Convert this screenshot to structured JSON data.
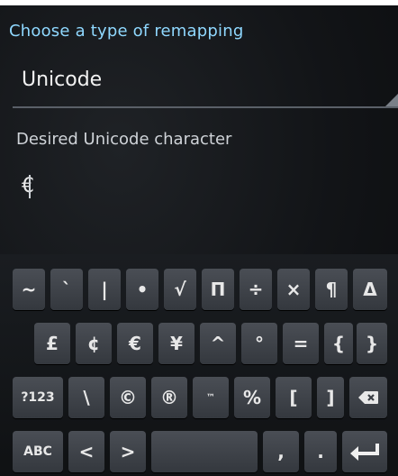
{
  "header": {
    "title": "Choose a type of remapping"
  },
  "spinner": {
    "value": "Unicode"
  },
  "field": {
    "label": "Desired Unicode character",
    "value": "€"
  },
  "keyboard": {
    "row1": [
      "~",
      "`",
      "|",
      "•",
      "√",
      "Π",
      "÷",
      "×",
      "¶",
      "Δ"
    ],
    "row2": [
      "£",
      "¢",
      "€",
      "¥",
      "^",
      "°",
      "=",
      "{",
      "}"
    ],
    "row3": [
      "?123",
      "\\",
      "©",
      "®",
      "™",
      "%",
      "[",
      "]"
    ],
    "row4": [
      "ABC",
      "<",
      ">",
      ",",
      "."
    ]
  }
}
